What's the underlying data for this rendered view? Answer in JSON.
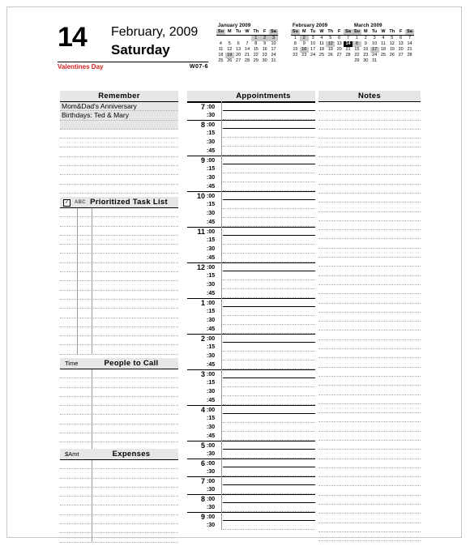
{
  "header": {
    "day_number": "14",
    "month_year": "February, 2009",
    "weekday": "Saturday",
    "holiday": "Valentines Day",
    "week_code": "W07-6"
  },
  "mini_calendars": [
    {
      "title": "January 2009",
      "weekday_headers": [
        "Su",
        "M",
        "Tu",
        "W",
        "Th",
        "F",
        "Sa"
      ],
      "weeks": [
        [
          "",
          "",
          "",
          "",
          "1",
          "2",
          "3"
        ],
        [
          "4",
          "5",
          "6",
          "7",
          "8",
          "9",
          "10"
        ],
        [
          "11",
          "12",
          "13",
          "14",
          "15",
          "16",
          "17"
        ],
        [
          "18",
          "19",
          "20",
          "21",
          "22",
          "23",
          "24"
        ],
        [
          "25",
          "26",
          "27",
          "28",
          "29",
          "30",
          "31"
        ]
      ],
      "shaded": [
        "1",
        "2",
        "3",
        "19"
      ],
      "today": ""
    },
    {
      "title": "February 2009",
      "weekday_headers": [
        "Su",
        "M",
        "Tu",
        "W",
        "Th",
        "F",
        "Sa"
      ],
      "weeks": [
        [
          "1",
          "2",
          "3",
          "4",
          "5",
          "6",
          "7"
        ],
        [
          "8",
          "9",
          "10",
          "11",
          "12",
          "13",
          "14"
        ],
        [
          "15",
          "16",
          "17",
          "18",
          "19",
          "20",
          "21"
        ],
        [
          "22",
          "23",
          "24",
          "25",
          "26",
          "27",
          "28"
        ]
      ],
      "shaded": [
        "2",
        "12",
        "16"
      ],
      "today": "14"
    },
    {
      "title": "March 2009",
      "weekday_headers": [
        "Su",
        "M",
        "Tu",
        "W",
        "Th",
        "F",
        "Sa"
      ],
      "weeks": [
        [
          "1",
          "2",
          "3",
          "4",
          "5",
          "6",
          "7"
        ],
        [
          "8",
          "9",
          "10",
          "11",
          "12",
          "13",
          "14"
        ],
        [
          "15",
          "16",
          "17",
          "18",
          "19",
          "20",
          "21"
        ],
        [
          "22",
          "23",
          "24",
          "25",
          "26",
          "27",
          "28"
        ],
        [
          "29",
          "30",
          "31",
          "",
          "",
          "",
          ""
        ]
      ],
      "shaded": [
        "8",
        "17"
      ],
      "today": ""
    }
  ],
  "remember": {
    "title": "Remember",
    "entries": [
      "Mom&Dad's Anniversary",
      "Birthdays: Ted & Mary"
    ],
    "empty_rows": 9
  },
  "task_list": {
    "title": "Prioritized Task List",
    "checkbox_icon": "checkbox-icon",
    "priority_label": "ABC",
    "rows": 16
  },
  "people_to_call": {
    "title": "People to Call",
    "column_label": "Time",
    "rows": 9
  },
  "expenses": {
    "title": "Expenses",
    "column_label": "$Amt",
    "rows": 9
  },
  "appointments": {
    "title": "Appointments",
    "slots": [
      {
        "hour": "7",
        "minute": ":00",
        "is_hour": true
      },
      {
        "hour": "",
        "minute": ":30",
        "is_hour": false
      },
      {
        "hour": "8",
        "minute": ":00",
        "is_hour": true
      },
      {
        "hour": "",
        "minute": ":15",
        "is_hour": false
      },
      {
        "hour": "",
        "minute": ":30",
        "is_hour": false
      },
      {
        "hour": "",
        "minute": ":45",
        "is_hour": false
      },
      {
        "hour": "9",
        "minute": ":00",
        "is_hour": true
      },
      {
        "hour": "",
        "minute": ":15",
        "is_hour": false
      },
      {
        "hour": "",
        "minute": ":30",
        "is_hour": false
      },
      {
        "hour": "",
        "minute": ":45",
        "is_hour": false
      },
      {
        "hour": "10",
        "minute": ":00",
        "is_hour": true
      },
      {
        "hour": "",
        "minute": ":15",
        "is_hour": false
      },
      {
        "hour": "",
        "minute": ":30",
        "is_hour": false
      },
      {
        "hour": "",
        "minute": ":45",
        "is_hour": false
      },
      {
        "hour": "11",
        "minute": ":00",
        "is_hour": true
      },
      {
        "hour": "",
        "minute": ":15",
        "is_hour": false
      },
      {
        "hour": "",
        "minute": ":30",
        "is_hour": false
      },
      {
        "hour": "",
        "minute": ":45",
        "is_hour": false
      },
      {
        "hour": "12",
        "minute": ":00",
        "is_hour": true
      },
      {
        "hour": "",
        "minute": ":15",
        "is_hour": false
      },
      {
        "hour": "",
        "minute": ":30",
        "is_hour": false
      },
      {
        "hour": "",
        "minute": ":45",
        "is_hour": false
      },
      {
        "hour": "1",
        "minute": ":00",
        "is_hour": true
      },
      {
        "hour": "",
        "minute": ":15",
        "is_hour": false
      },
      {
        "hour": "",
        "minute": ":30",
        "is_hour": false
      },
      {
        "hour": "",
        "minute": ":45",
        "is_hour": false
      },
      {
        "hour": "2",
        "minute": ":00",
        "is_hour": true
      },
      {
        "hour": "",
        "minute": ":15",
        "is_hour": false
      },
      {
        "hour": "",
        "minute": ":30",
        "is_hour": false
      },
      {
        "hour": "",
        "minute": ":45",
        "is_hour": false
      },
      {
        "hour": "3",
        "minute": ":00",
        "is_hour": true
      },
      {
        "hour": "",
        "minute": ":15",
        "is_hour": false
      },
      {
        "hour": "",
        "minute": ":30",
        "is_hour": false
      },
      {
        "hour": "",
        "minute": ":45",
        "is_hour": false
      },
      {
        "hour": "4",
        "minute": ":00",
        "is_hour": true
      },
      {
        "hour": "",
        "minute": ":15",
        "is_hour": false
      },
      {
        "hour": "",
        "minute": ":30",
        "is_hour": false
      },
      {
        "hour": "",
        "minute": ":45",
        "is_hour": false
      },
      {
        "hour": "5",
        "minute": ":00",
        "is_hour": true
      },
      {
        "hour": "",
        "minute": ":30",
        "is_hour": false
      },
      {
        "hour": "6",
        "minute": ":00",
        "is_hour": true
      },
      {
        "hour": "",
        "minute": ":30",
        "is_hour": false
      },
      {
        "hour": "7",
        "minute": ":00",
        "is_hour": true
      },
      {
        "hour": "",
        "minute": ":30",
        "is_hour": false
      },
      {
        "hour": "8",
        "minute": ":00",
        "is_hour": true
      },
      {
        "hour": "",
        "minute": ":30",
        "is_hour": false
      },
      {
        "hour": "9",
        "minute": ":00",
        "is_hour": true
      },
      {
        "hour": "",
        "minute": ":30",
        "is_hour": false
      }
    ]
  },
  "notes": {
    "title": "Notes",
    "rows": 48
  }
}
